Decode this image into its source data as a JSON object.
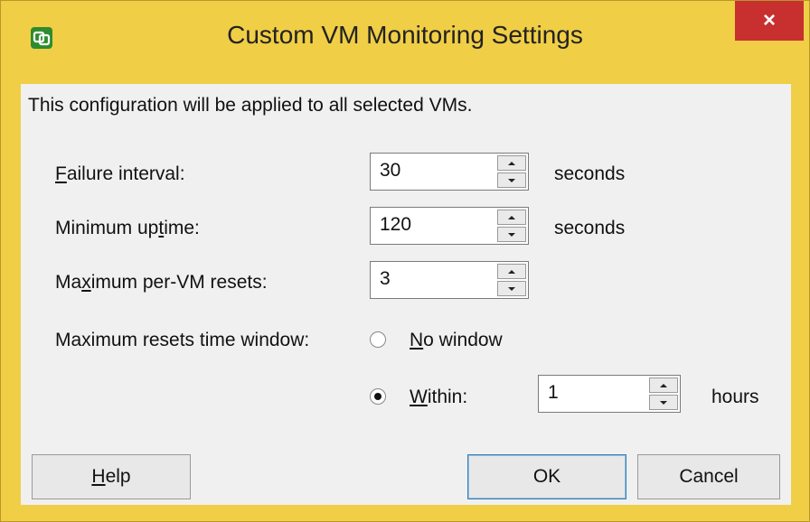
{
  "window": {
    "title": "Custom VM Monitoring Settings",
    "close_label": "×",
    "frame_color": "#f0ce46",
    "close_color": "#c7302f"
  },
  "description": "This configuration will be applied to all selected VMs.",
  "fields": {
    "failure_interval": {
      "label_mn": "F",
      "label_rest": "ailure interval:",
      "value": "30",
      "unit": "seconds"
    },
    "minimum_uptime": {
      "label_pre": "Minimum up",
      "label_mn": "t",
      "label_post": "ime:",
      "value": "120",
      "unit": "seconds"
    },
    "max_resets": {
      "label_pre": "Ma",
      "label_mn": "x",
      "label_post": "imum per-VM resets:",
      "value": "3"
    },
    "time_window": {
      "label": "Maximum resets time window:",
      "option_no_window": {
        "mn": "N",
        "rest": "o window",
        "selected": false
      },
      "option_within": {
        "mn": "W",
        "rest": "ithin:",
        "selected": true
      },
      "within_value": "1",
      "within_unit": "hours"
    }
  },
  "buttons": {
    "help": {
      "mn": "H",
      "rest": "elp"
    },
    "ok": "OK",
    "cancel": "Cancel"
  }
}
